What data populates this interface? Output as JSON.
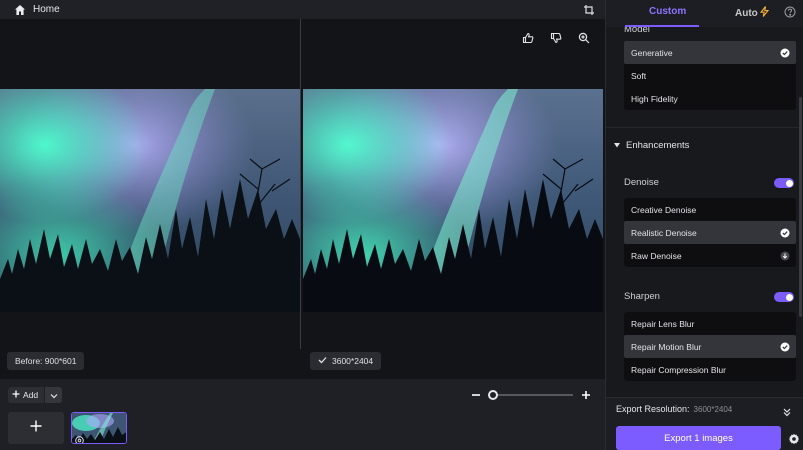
{
  "topbar": {
    "home_label": "Home"
  },
  "viewer": {
    "before_label": "Before: 900*601",
    "after_label": "3600*2404"
  },
  "bottom": {
    "add_label": "Add",
    "zoom_level": 0.05
  },
  "panel": {
    "tabs": [
      {
        "label": "Custom",
        "active": true
      },
      {
        "label": "Auto",
        "active": false
      }
    ],
    "model": {
      "label": "Model",
      "options": [
        {
          "label": "Generative",
          "selected": true
        },
        {
          "label": "Soft",
          "selected": false
        },
        {
          "label": "High Fidelity",
          "selected": false
        }
      ]
    },
    "enhancements": {
      "title": "Enhancements",
      "denoise": {
        "label": "Denoise",
        "enabled": true,
        "options": [
          {
            "label": "Creative Denoise",
            "selected": false
          },
          {
            "label": "Realistic Denoise",
            "selected": true
          },
          {
            "label": "Raw Denoise",
            "selected": false
          }
        ]
      },
      "sharpen": {
        "label": "Sharpen",
        "enabled": true,
        "options": [
          {
            "label": "Repair Lens Blur",
            "selected": false
          },
          {
            "label": "Repair Motion Blur",
            "selected": true
          },
          {
            "label": "Repair Compression Blur",
            "selected": false
          }
        ]
      }
    },
    "export": {
      "resolution_label": "Export Resolution:",
      "resolution_value": "3600*2404",
      "button_label": "Export 1 images"
    }
  },
  "colors": {
    "accent": "#7c5cff",
    "background": "#1a1b1f",
    "panel": "#18191d"
  },
  "icons": [
    "home-icon",
    "crop-icon",
    "thumbs-up-icon",
    "thumbs-down-icon",
    "zoom-in-icon",
    "check-icon",
    "plus-icon",
    "chevron-down-icon",
    "minus-icon",
    "eye-icon",
    "lightning-icon",
    "help-icon",
    "caret-down-icon",
    "download-icon",
    "gear-icon"
  ]
}
